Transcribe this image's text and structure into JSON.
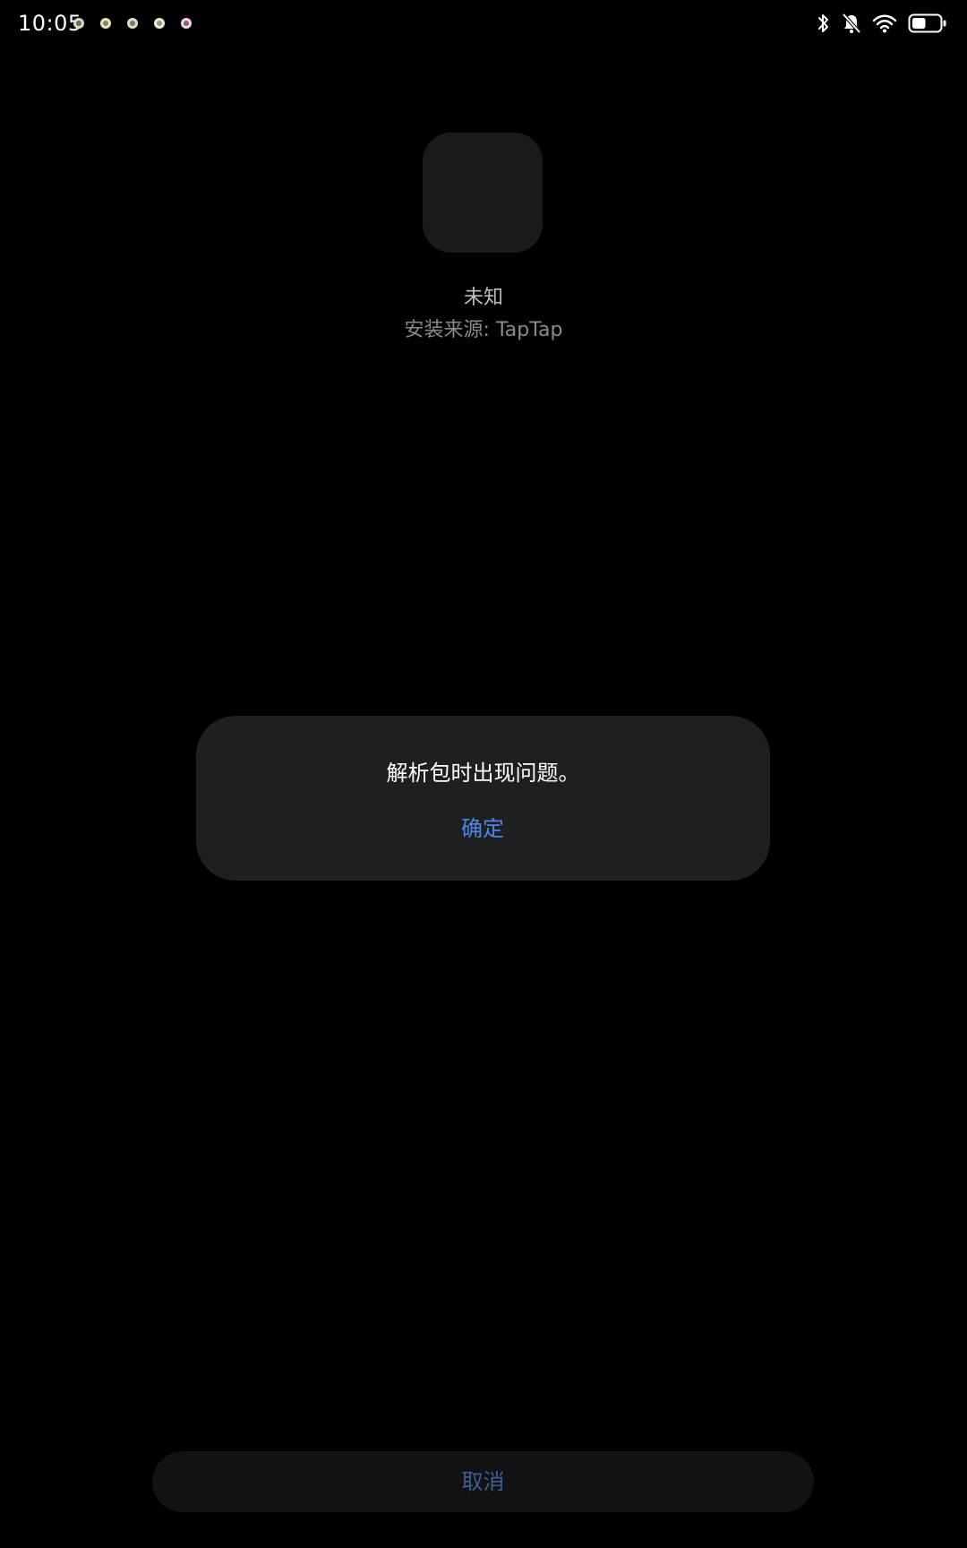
{
  "status_bar": {
    "time": "10:05",
    "notification_icons": [
      "app-notification-icon",
      "app-notification-icon",
      "app-notification-icon",
      "app-notification-icon",
      "app-notification-icon"
    ],
    "right_icons": [
      "bluetooth-icon",
      "bell-muted-icon",
      "wifi-icon",
      "battery-icon"
    ],
    "battery_level": 0.5
  },
  "app": {
    "name": "未知",
    "install_source": "安装来源: TapTap"
  },
  "dialog": {
    "message": "解析包时出现问题。",
    "confirm_label": "确定"
  },
  "footer": {
    "cancel_label": "取消"
  },
  "colors": {
    "background": "#000000",
    "dialog_bg": "#1e1f21",
    "accent": "#4f86e6",
    "cancel_text": "#3c5f99"
  }
}
